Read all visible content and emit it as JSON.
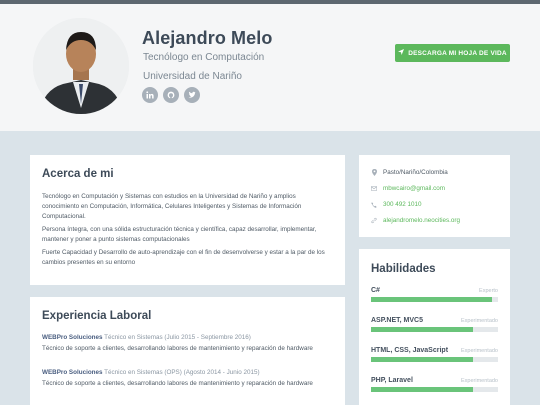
{
  "profile": {
    "name": "Alejandro Melo",
    "title": "Tecnólogo en Computación",
    "university": "Universidad de Nariño",
    "cv_button": "DESCARGA MI HOJA DE VIDA",
    "socials": [
      "linkedin-icon",
      "github-icon",
      "twitter-icon"
    ]
  },
  "about": {
    "heading": "Acerca de mi",
    "paragraphs": [
      "Tecnólogo en Computación y Sistemas con estudios en la Universidad de Nariño y amplios conocimiento en Computación, Informática, Celulares Inteligentes y Sistemas de Información Computacional.",
      "Persona íntegra, con una sólida estructuración técnica y científica, capaz desarrollar, implementar, mantener y poner a punto sistemas computacionales",
      "Fuerte Capacidad y Desarrollo de auto-aprendizaje con el fin de desenvolverse y estar a la par de los cambios presentes en su entorno"
    ]
  },
  "experience": {
    "heading": "Experiencia Laboral",
    "jobs": [
      {
        "company": "WEBPro Soluciones",
        "role": " Técnico en Sistemas (Julio 2015 - Septiembre 2016)",
        "description": "Técnico de soporte a clientes, desarrollando labores de mantenimiento y reparación de hardware"
      },
      {
        "company": "WEBPro Soluciones",
        "role": " Técnico en Sistemas (OPS) (Agosto 2014 - Junio 2015)",
        "description": "Técnico de soporte a clientes, desarrollando labores de mantenimiento y reparación de hardware"
      }
    ]
  },
  "contact": {
    "location": "Pasto/Nariño/Colombia",
    "email": "mbwcairo@gmail.com",
    "phone": "300 492 1010",
    "website": "alejandromelo.neocities.org"
  },
  "skills": {
    "heading": "Habilidades",
    "items": [
      {
        "name": "C#",
        "level": "Experto",
        "fraction": 0.95
      },
      {
        "name": "ASP.NET, MVC5",
        "level": "Experimentado",
        "fraction": 0.8
      },
      {
        "name": "HTML, CSS, JavaScript",
        "level": "Experimentado",
        "fraction": 0.8
      },
      {
        "name": "PHP, Laravel",
        "level": "Experimentado",
        "fraction": 0.8
      }
    ]
  },
  "colors": {
    "accent_green": "#5cb85c",
    "skill_bar": "#6ac47a",
    "link_green": "#5cb85c",
    "company_blue": "#4a5e80"
  }
}
